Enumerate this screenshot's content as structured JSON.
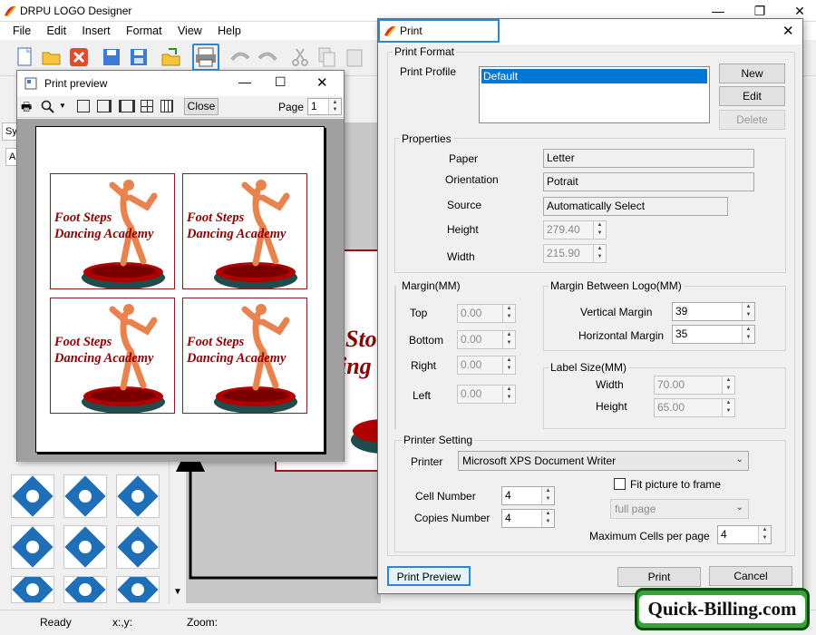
{
  "app": {
    "title": "DRPU LOGO Designer"
  },
  "menu": [
    "File",
    "Edit",
    "Insert",
    "Format",
    "View",
    "Help"
  ],
  "left_panel": {
    "tab_label": "Sy",
    "sub_tab_label": "A"
  },
  "canvas": {
    "partial_text_1": "Sto",
    "partial_text_2": "ing"
  },
  "preview": {
    "title": "Print preview",
    "close_label": "Close",
    "page_label": "Page",
    "page_value": "1",
    "cards": [
      {
        "line1": "Foot Steps",
        "line2": "Dancing Academy"
      },
      {
        "line1": "Foot Steps",
        "line2": "Dancing Academy"
      },
      {
        "line1": "Foot Steps",
        "line2": "Dancing Academy"
      },
      {
        "line1": "Foot Steps",
        "line2": "Dancing Academy"
      }
    ]
  },
  "dialog": {
    "title": "Print",
    "print_format": {
      "title": "Print Format",
      "profile_label": "Print Profile",
      "profiles": [
        "Default"
      ],
      "new_label": "New",
      "edit_label": "Edit",
      "delete_label": "Delete"
    },
    "properties": {
      "title": "Properties",
      "paper_label": "Paper",
      "paper_value": "Letter",
      "orientation_label": "Orientation",
      "orientation_value": "Potrait",
      "source_label": "Source",
      "source_value": "Automatically Select",
      "height_label": "Height",
      "height_value": "279.40",
      "width_label": "Width",
      "width_value": "215.90"
    },
    "margin": {
      "title": "Margin(MM)",
      "top_label": "Top",
      "top_value": "0.00",
      "bottom_label": "Bottom",
      "bottom_value": "0.00",
      "right_label": "Right",
      "right_value": "0.00",
      "left_label": "Left",
      "left_value": "0.00"
    },
    "margin_between": {
      "title": "Margin Between Logo(MM)",
      "vertical_label": "Vertical Margin",
      "vertical_value": "39",
      "horizontal_label": "Horizontal Margin",
      "horizontal_value": "35"
    },
    "label_size": {
      "title": "Label Size(MM)",
      "width_label": "Width",
      "width_value": "70.00",
      "height_label": "Height",
      "height_value": "65.00"
    },
    "printer_setting": {
      "title": "Printer Setting",
      "printer_label": "Printer",
      "printer_value": "Microsoft XPS Document Writer",
      "fit_label": "Fit picture to frame",
      "fit_option": "full page",
      "cell_label": "Cell Number",
      "cell_value": "4",
      "copies_label": "Copies Number",
      "copies_value": "4",
      "max_cells_label": "Maximum Cells per page",
      "max_cells_value": "4"
    },
    "print_preview_label": "Print Preview",
    "print_label": "Print",
    "cancel_label": "Cancel"
  },
  "status": {
    "ready": "Ready",
    "coords": "x:,y:",
    "zoom": "Zoom:"
  },
  "watermark": "Quick-Billing.com",
  "colors": {
    "accent": "#2b87d6",
    "logo_red": "#8b0000",
    "icon_blue": "#1f6fb8"
  }
}
